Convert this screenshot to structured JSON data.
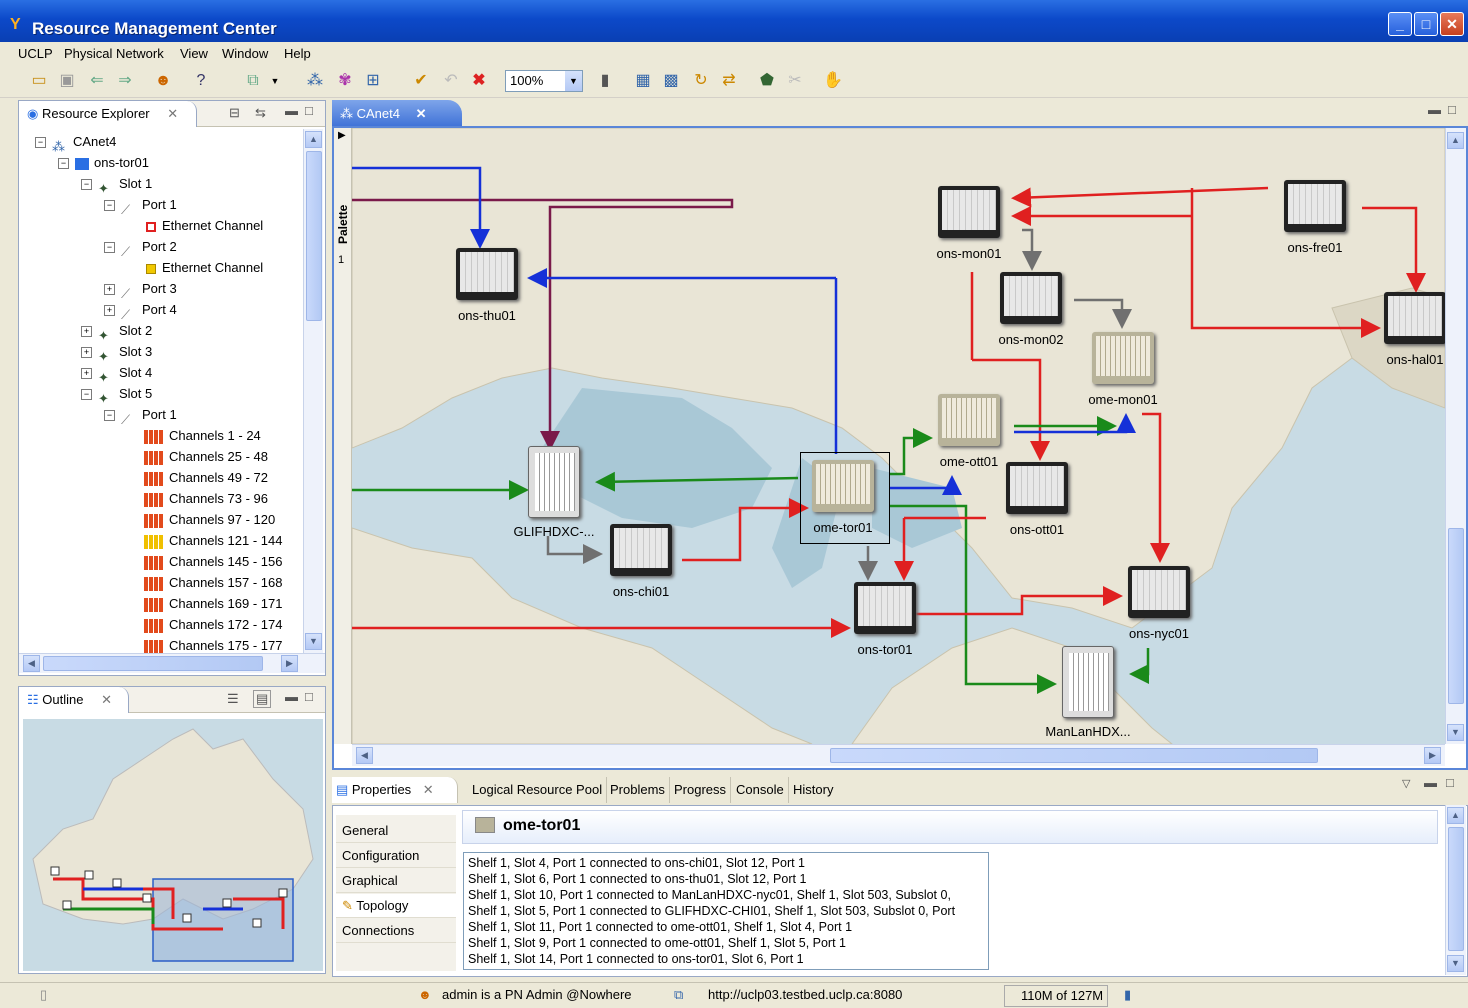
{
  "window": {
    "title": "Resource  Management Center"
  },
  "menu": [
    "UCLP",
    "Physical Network",
    "View",
    "Window",
    "Help"
  ],
  "toolbar": {
    "zoom": "100%"
  },
  "explorer": {
    "tab_label": "Resource Explorer",
    "tree": [
      {
        "label": "CAnet4",
        "level": 0,
        "toggle": "−",
        "icon": "network-icon"
      },
      {
        "label": "ons-tor01",
        "level": 1,
        "toggle": "−",
        "icon": "device-icon"
      },
      {
        "label": "Slot 1",
        "level": 2,
        "toggle": "−",
        "icon": "slot-icon"
      },
      {
        "label": "Port 1",
        "level": 3,
        "toggle": "−",
        "icon": "port-icon"
      },
      {
        "label": "Ethernet Channel",
        "level": 4,
        "toggle": "",
        "icon": "ethernet-red-icon"
      },
      {
        "label": "Port 2",
        "level": 3,
        "toggle": "−",
        "icon": "port-icon"
      },
      {
        "label": "Ethernet Channel",
        "level": 4,
        "toggle": "",
        "icon": "ethernet-yellow-icon"
      },
      {
        "label": "Port 3",
        "level": 3,
        "toggle": "+",
        "icon": "port-icon"
      },
      {
        "label": "Port 4",
        "level": 3,
        "toggle": "+",
        "icon": "port-icon"
      },
      {
        "label": "Slot 2",
        "level": 2,
        "toggle": "+",
        "icon": "slot-icon"
      },
      {
        "label": "Slot 3",
        "level": 2,
        "toggle": "+",
        "icon": "slot-icon"
      },
      {
        "label": "Slot 4",
        "level": 2,
        "toggle": "+",
        "icon": "slot-icon"
      },
      {
        "label": "Slot 5",
        "level": 2,
        "toggle": "−",
        "icon": "slot-icon"
      },
      {
        "label": "Port 1",
        "level": 3,
        "toggle": "−",
        "icon": "port-icon"
      },
      {
        "label": "Channels 1 - 24",
        "level": 4,
        "toggle": "",
        "icon": "channels-red-icon"
      },
      {
        "label": "Channels 25 - 48",
        "level": 4,
        "toggle": "",
        "icon": "channels-red-icon"
      },
      {
        "label": "Channels 49 - 72",
        "level": 4,
        "toggle": "",
        "icon": "channels-red-icon"
      },
      {
        "label": "Channels 73 - 96",
        "level": 4,
        "toggle": "",
        "icon": "channels-red-icon"
      },
      {
        "label": "Channels 97 - 120",
        "level": 4,
        "toggle": "",
        "icon": "channels-red-icon"
      },
      {
        "label": "Channels 121 - 144",
        "level": 4,
        "toggle": "",
        "icon": "channels-yellow-icon"
      },
      {
        "label": "Channels 145 - 156",
        "level": 4,
        "toggle": "",
        "icon": "channels-red-icon"
      },
      {
        "label": "Channels 157 - 168",
        "level": 4,
        "toggle": "",
        "icon": "channels-red-icon"
      },
      {
        "label": "Channels 169 - 171",
        "level": 4,
        "toggle": "",
        "icon": "channels-red-icon"
      },
      {
        "label": "Channels 172 - 174",
        "level": 4,
        "toggle": "",
        "icon": "channels-red-icon"
      },
      {
        "label": "Channels 175 - 177",
        "level": 4,
        "toggle": "",
        "icon": "channels-red-icon"
      }
    ]
  },
  "outline": {
    "tab_label": "Outline"
  },
  "editor": {
    "tab_label": "CAnet4",
    "palette_label": "Palette",
    "palette_number": "1",
    "nodes": [
      {
        "id": "ons-thu01",
        "label": "ons-thu01",
        "kind": "ons"
      },
      {
        "id": "ons-mon01",
        "label": "ons-mon01",
        "kind": "ons"
      },
      {
        "id": "ons-fre01",
        "label": "ons-fre01",
        "kind": "ons"
      },
      {
        "id": "ons-mon02",
        "label": "ons-mon02",
        "kind": "ons"
      },
      {
        "id": "ons-hal01",
        "label": "ons-hal01",
        "kind": "ons"
      },
      {
        "id": "ome-mon01",
        "label": "ome-mon01",
        "kind": "ome"
      },
      {
        "id": "ome-ott01",
        "label": "ome-ott01",
        "kind": "ome"
      },
      {
        "id": "ome-tor01",
        "label": "ome-tor01",
        "kind": "ome"
      },
      {
        "id": "ons-ott01",
        "label": "ons-ott01",
        "kind": "ons"
      },
      {
        "id": "GLIFHDXC",
        "label": "GLIFHDXC-...",
        "kind": "hdxc"
      },
      {
        "id": "ons-chi01",
        "label": "ons-chi01",
        "kind": "ons"
      },
      {
        "id": "ons-tor01",
        "label": "ons-tor01",
        "kind": "ons"
      },
      {
        "id": "ons-nyc01",
        "label": "ons-nyc01",
        "kind": "ons"
      },
      {
        "id": "ManLanHDX",
        "label": "ManLanHDX...",
        "kind": "hdxc"
      }
    ]
  },
  "bottom_tabs": [
    "Properties",
    "Logical Resource Pool",
    "Problems",
    "Progress",
    "Console",
    "History"
  ],
  "properties": {
    "categories": [
      "General",
      "Configuration",
      "Graphical",
      "Topology",
      "Connections"
    ],
    "selected_category": "Topology",
    "title": "ome-tor01",
    "lines": [
      "Shelf 1, Slot 4, Port 1 connected to ons-chi01, Slot 12, Port 1",
      "Shelf 1, Slot 6, Port 1 connected to ons-thu01, Slot 12, Port 1",
      "Shelf 1, Slot 10, Port 1 connected to ManLanHDXC-nyc01, Shelf 1, Slot 503, Subslot 0,",
      "Shelf 1, Slot 5, Port 1 connected to GLIFHDXC-CHI01, Shelf 1, Slot 503, Subslot 0, Port",
      "Shelf 1, Slot 11, Port 1 connected to ome-ott01, Shelf 1, Slot 4, Port 1",
      "Shelf 1, Slot 9, Port 1 connected to ome-ott01, Shelf 1, Slot 5, Port 1",
      "Shelf 1, Slot 14, Port 1 connected to ons-tor01, Slot 6, Port 1"
    ]
  },
  "status": {
    "user": "admin is a PN Admin @Nowhere",
    "url": "http://uclp03.testbed.uclp.ca:8080",
    "memory": "110M of 127M"
  },
  "colors": {
    "link_red": "#e02020",
    "link_green": "#1a8a1a",
    "link_blue": "#1530d8",
    "link_purple": "#7a1a4a",
    "link_gray": "#707070",
    "title_blue": "#0c49c9"
  }
}
